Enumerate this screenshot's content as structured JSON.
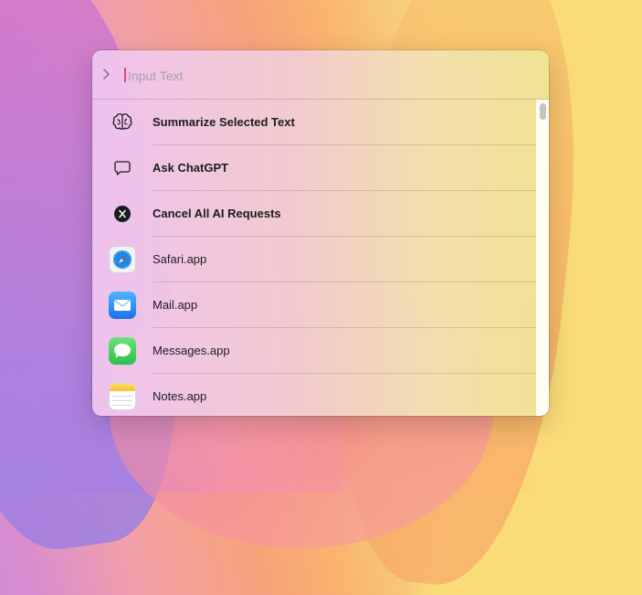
{
  "search": {
    "placeholder": "Input Text",
    "value": ""
  },
  "results": [
    {
      "label": "Summarize Selected Text",
      "icon": "brain-icon",
      "bold": true
    },
    {
      "label": "Ask ChatGPT",
      "icon": "chat-bubble-icon",
      "bold": true
    },
    {
      "label": "Cancel All AI Requests",
      "icon": "cancel-x-icon",
      "bold": true
    },
    {
      "label": "Safari.app",
      "icon": "safari-icon",
      "bold": false
    },
    {
      "label": "Mail.app",
      "icon": "mail-icon",
      "bold": false
    },
    {
      "label": "Messages.app",
      "icon": "messages-icon",
      "bold": false
    },
    {
      "label": "Notes.app",
      "icon": "notes-icon",
      "bold": false
    }
  ],
  "colors": {
    "caret": "#e0457c",
    "safari": "#1e88e5",
    "mail": "#2a8cf5",
    "messages": "#34c759",
    "notes": "#f7c948"
  }
}
